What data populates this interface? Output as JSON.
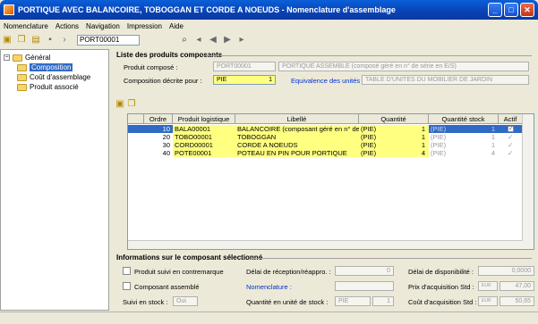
{
  "window": {
    "title": "PORTIQUE AVEC BALANCOIRE, TOBOGGAN ET CORDE A NOEUDS - Nomenclature d'assemblage"
  },
  "menu": [
    "Nomenclature",
    "Actions",
    "Navigation",
    "Impression",
    "Aide"
  ],
  "toolbar": {
    "code": "PORT00001"
  },
  "tree": {
    "root": "Général",
    "items": [
      "Composition",
      "Coût d'assemblage",
      "Produit associé"
    ]
  },
  "header": {
    "section_title": "Liste des produits composants",
    "produit_compose_label": "Produit composé :",
    "produit_compose_code": "PORT00001",
    "produit_compose_desc": "PORTIQUE ASSEMBLE (composé géré en n° de série en E/S)",
    "composition_label": "Composition décrite pour :",
    "composition_unit": "PIE",
    "composition_qty": "1",
    "equivalence_label": "Equivalence des unités :",
    "equivalence_value": "TABLE D'UNITES DU MOBILIER DE JARDIN"
  },
  "grid": {
    "columns": [
      "Ordre",
      "Produit logistique",
      "Libellé",
      "Quantité",
      "Quantité stock",
      "Actif"
    ],
    "rows": [
      {
        "ordre": "10",
        "produit": "BALA00001",
        "libelle": "BALANCOIRE (composant géré en n° de",
        "unit": "(PIE)",
        "qty": "1",
        "stock_unit": "(PIE)",
        "stock_qty": "1",
        "actif": "✓"
      },
      {
        "ordre": "20",
        "produit": "TOBO00001",
        "libelle": "TOBOGGAN",
        "unit": "(PIE)",
        "qty": "1",
        "stock_unit": "(PIE)",
        "stock_qty": "1",
        "actif": "✓"
      },
      {
        "ordre": "30",
        "produit": "CORD00001",
        "libelle": "CORDE A NOEUDS",
        "unit": "(PIE)",
        "qty": "1",
        "stock_unit": "(PIE)",
        "stock_qty": "1",
        "actif": "✓"
      },
      {
        "ordre": "40",
        "produit": "POTE00001",
        "libelle": "POTEAU EN PIN POUR PORTIQUE",
        "unit": "(PIE)",
        "qty": "4",
        "stock_unit": "(PIE)",
        "stock_qty": "4",
        "actif": "✓"
      }
    ]
  },
  "info": {
    "section_title": "Informations sur le composant sélectionné",
    "suivi_contremarque": "Produit suivi en contremarque",
    "compose_assemble": "Composant assemblé",
    "suivi_stock_label": "Suivi en stock :",
    "suivi_stock_value": "Oui",
    "delai_reception_label": "Délai de réception/réappro. :",
    "delai_reception_value": "0",
    "nomenclature_label": "Nomenclature :",
    "qte_unite_stock_label": "Quantité en unité de stock :",
    "qte_unite_stock_unit": "PIE",
    "qte_unite_stock_value": "1",
    "delai_dispo_label": "Délai de disponibilité :",
    "delai_dispo_value": "0,0000",
    "prix_acq_label": "Prix d'acquisition Std :",
    "prix_acq_cur": "EUR",
    "prix_acq_value": "47,00",
    "cout_acq_label": "Coût d'acquisition Std :",
    "cout_acq_cur": "EUR",
    "cout_acq_value": "50,65"
  }
}
